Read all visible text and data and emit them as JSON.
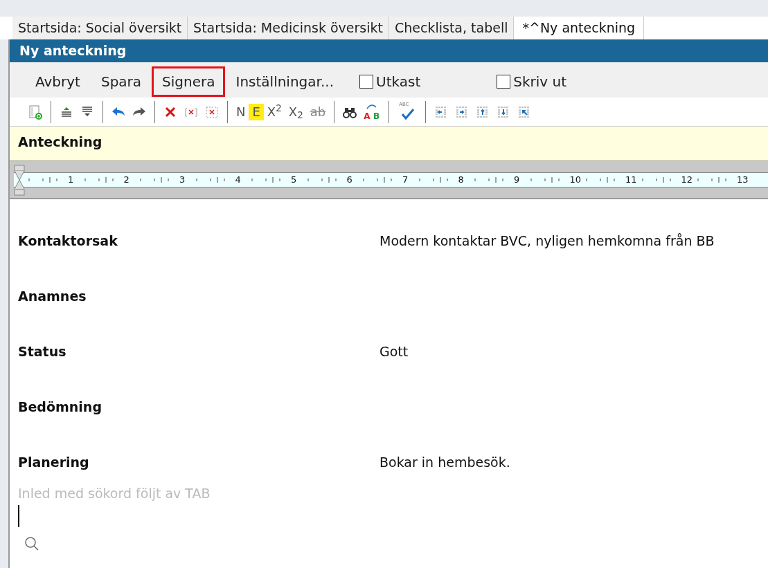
{
  "tabs": [
    {
      "label": "Startsida: Social översikt",
      "selected": false
    },
    {
      "label": "Startsida: Medicinsk översikt",
      "selected": false
    },
    {
      "label": "Checklista, tabell",
      "selected": false
    },
    {
      "label": "*^Ny anteckning",
      "selected": true
    }
  ],
  "title": "Ny anteckning",
  "menu": [
    {
      "kind": "button",
      "label": "Avbryt",
      "highlighted": false
    },
    {
      "kind": "button",
      "label": "Spara",
      "highlighted": false
    },
    {
      "kind": "button",
      "label": "Signera",
      "highlighted": true
    },
    {
      "kind": "button",
      "label": "Inställningar...",
      "highlighted": false
    },
    {
      "kind": "checkbox",
      "label": "Utkast",
      "checked": false
    },
    {
      "kind": "checkbox",
      "label": "Skriv ut",
      "checked": false
    }
  ],
  "toolbar": [
    [
      {
        "kind": "icon"
      }
    ],
    [
      {
        "kind": "icon"
      },
      {
        "kind": "icon"
      }
    ],
    [
      {
        "kind": "icon"
      },
      {
        "kind": "icon"
      }
    ],
    [
      {
        "kind": "icon"
      },
      {
        "kind": "icon"
      },
      {
        "kind": "icon"
      }
    ],
    [
      {
        "kind": "text",
        "label": "N",
        "highlighted": false,
        "strike": false
      },
      {
        "kind": "text",
        "label": "E",
        "highlighted": true,
        "strike": false
      },
      {
        "kind": "text",
        "label": "X$^{2}$",
        "highlighted": false,
        "strike": false
      },
      {
        "kind": "text",
        "label": "X$_{2}$",
        "highlighted": false,
        "strike": false
      },
      {
        "kind": "text",
        "label": "ab",
        "highlighted": false,
        "strike": true
      }
    ],
    [
      {
        "kind": "icon"
      },
      {
        "kind": "replace",
        "from": "A",
        "to": "B"
      }
    ],
    [
      {
        "kind": "spell",
        "label": "ABC"
      }
    ],
    [
      {
        "kind": "icon"
      },
      {
        "kind": "icon"
      },
      {
        "kind": "icon"
      },
      {
        "kind": "icon"
      },
      {
        "kind": "icon"
      }
    ]
  ],
  "section_title": "Anteckning",
  "ruler": [
    "1",
    "2",
    "3",
    "4",
    "5",
    "6",
    "7",
    "8",
    "9",
    "10",
    "11",
    "12",
    "13"
  ],
  "fields": [
    {
      "label": "Kontaktorsak",
      "value": "Modern kontaktar BVC, nyligen hemkomna från BB"
    },
    {
      "label": "Anamnes"
    },
    {
      "label": "Status",
      "value": "Gott"
    },
    {
      "label": "Bedömning"
    },
    {
      "label": "Planering",
      "value": "Bokar in hembesök."
    }
  ],
  "keyword_input": {
    "placeholder": "Inled med sökord följt av TAB"
  }
}
